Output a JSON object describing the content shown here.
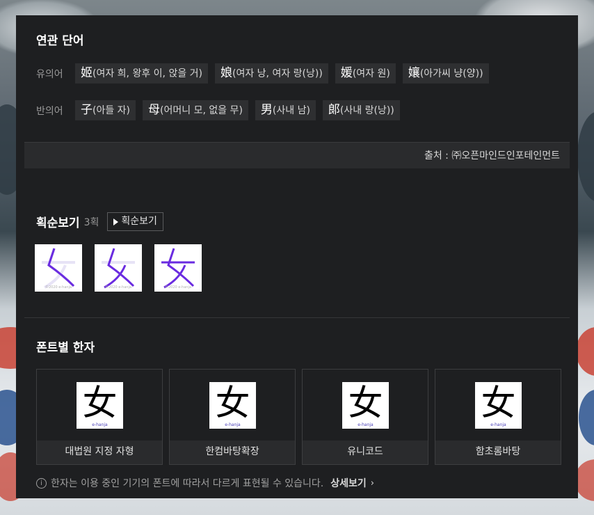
{
  "related": {
    "title": "연관 단어",
    "synonyms": {
      "label": "유의어",
      "items": [
        {
          "han": "姬",
          "reading": "(여자 희, 왕후 이, 앉을 거)"
        },
        {
          "han": "娘",
          "reading": "(여자 낭, 여자 랑(낭))"
        },
        {
          "han": "媛",
          "reading": "(여자 원)"
        },
        {
          "han": "孃",
          "reading": "(아가씨 냥(양))"
        }
      ]
    },
    "antonyms": {
      "label": "반의어",
      "items": [
        {
          "han": "子",
          "reading": "(아들 자)"
        },
        {
          "han": "母",
          "reading": "(어머니 모, 없을 무)"
        },
        {
          "han": "男",
          "reading": "(사내 남)"
        },
        {
          "han": "郞",
          "reading": "(사내 랑(낭))"
        }
      ]
    },
    "source": "출처 : ㈜오픈마인드인포테인먼트"
  },
  "strokes": {
    "title": "획순보기",
    "count": "3획",
    "button_label": "획순보기",
    "watermark": "©2020 e-hanja",
    "steps": 3
  },
  "fonts": {
    "title": "폰트별 한자",
    "glyph": "女",
    "brand": "e-hanja",
    "cards": [
      {
        "caption": "대법원 지정 자형"
      },
      {
        "caption": "한컴바탕확장"
      },
      {
        "caption": "유니코드"
      },
      {
        "caption": "함초롬바탕"
      }
    ]
  },
  "notice": {
    "text": "한자는 이용 중인 기기의 폰트에 따라서 다르게 표현될 수 있습니다.",
    "more_label": "상세보기"
  },
  "colors": {
    "panel": "#1e1f21",
    "stroke_ink": "#6a2be0",
    "stroke_ghost": "#e7e3f6"
  }
}
